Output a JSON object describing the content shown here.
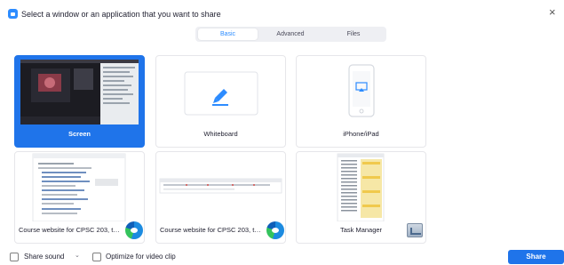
{
  "header": {
    "title": "Select a window or an application that you want to share",
    "close_symbol": "×"
  },
  "tabs": [
    {
      "label": "Basic",
      "active": true
    },
    {
      "label": "Advanced",
      "active": false
    },
    {
      "label": "Files",
      "active": false
    }
  ],
  "share_items": [
    {
      "label": "Screen",
      "selected": true,
      "icon": "screen-preview"
    },
    {
      "label": "Whiteboard",
      "selected": false,
      "icon": "pencil-icon"
    },
    {
      "label": "iPhone/iPad",
      "selected": false,
      "icon": "iphone-airplay-icon"
    },
    {
      "label": "Course website for CPSC 203, the...",
      "selected": false,
      "icon": "edge-browser-icon"
    },
    {
      "label": "Course website for CPSC 203, the...",
      "selected": false,
      "icon": "edge-browser-icon"
    },
    {
      "label": "Task Manager",
      "selected": false,
      "icon": "task-manager-icon"
    }
  ],
  "footer": {
    "share_sound_label": "Share sound",
    "share_sound_checked": false,
    "optimize_label": "Optimize for video clip",
    "optimize_checked": false,
    "share_button_label": "Share"
  },
  "colors": {
    "accent": "#1f74ea",
    "tab_active_text": "#2d8cff"
  }
}
